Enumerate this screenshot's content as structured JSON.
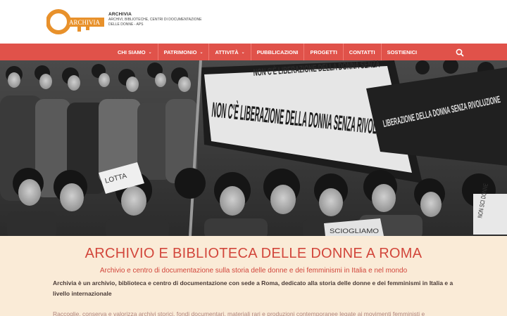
{
  "site": {
    "logo_text": "ARCHIVIA",
    "name": "ARCHIVIA",
    "subtitle": "ARCHIVI, BIBLIOTECHE, CENTRI DI DOCUMENTAZIONE DELLE DONNE - APS"
  },
  "nav": {
    "items": [
      {
        "label": "CHI SIAMO",
        "has_dropdown": true
      },
      {
        "label": "PATRIMONIO",
        "has_dropdown": true
      },
      {
        "label": "ATTIVITÀ",
        "has_dropdown": true
      },
      {
        "label": "PUBBLICAZIONI",
        "has_dropdown": false
      },
      {
        "label": "PROGETTI",
        "has_dropdown": false
      },
      {
        "label": "CONTATTI",
        "has_dropdown": false
      },
      {
        "label": "SOSTIENICI",
        "has_dropdown": false
      }
    ],
    "search_icon": "search-icon"
  },
  "hero": {
    "banner_text": "NON C'È LIBERAZIONE DELLA DONNA SENZA RIVOLUZIONE",
    "upper_banner_text": "NON C'È LIBERAZIONE DELLA DONNA SENZA",
    "right_banner_text": "LIBERAZIONE DELLA DONNA SENZA RIVOLUZIONE",
    "sign_left": "LOTTA",
    "sign_right": "NON SCI DONNE",
    "sign_bottom": "SCIOGLIAMO"
  },
  "main": {
    "title": "ARCHIVIO E BIBLIOTECA DELLE DONNE A ROMA",
    "subtitle": "Archivio e centro di documentazione sulla storia delle donne e dei femminismi in Italia e nel mondo",
    "intro_bold": "Archivia",
    "intro_rest": " è un archivio, biblioteca e centro di documentazione con sede a Roma, dedicato alla storia delle donne e dei femminismi in Italia e a livello internazionale",
    "body": "Raccoglie, conserva e valorizza archivi storici, fondi documentari, materiali rari e produzioni contemporanee legate ai movimenti femministi e"
  },
  "colors": {
    "accent": "#e0524a",
    "title": "#d2463b",
    "content_bg": "#faebd7",
    "logo_orange": "#e8912b"
  }
}
